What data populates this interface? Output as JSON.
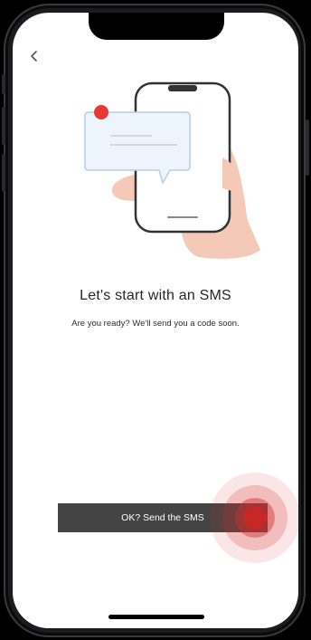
{
  "navigation": {
    "back_icon": "chevron-left-icon"
  },
  "illustration": {
    "icon": "phone-with-message-bubble-icon",
    "colors": {
      "hand": "#f4c9b8",
      "notification_dot": "#e53935",
      "phone_outline": "#333333",
      "bubble_fill": "#eef4fb",
      "bubble_outline": "#b7cde6"
    }
  },
  "content": {
    "title": "Let's start with an SMS",
    "subtitle": "Are you ready? We'll send you a code soon."
  },
  "actions": {
    "send_label": "OK? Send the SMS"
  },
  "theme": {
    "button_background": "#444444",
    "button_text": "#ffffff",
    "tap_indicator": "#d32f2f"
  }
}
